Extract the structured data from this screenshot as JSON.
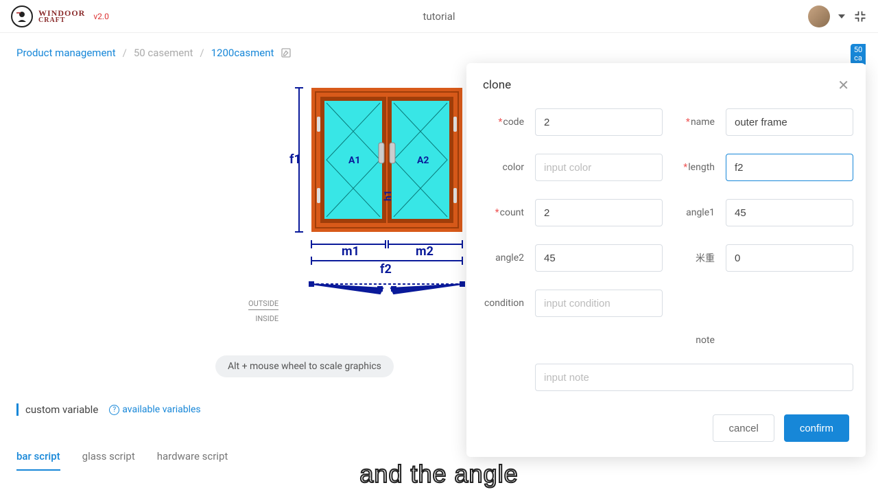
{
  "header": {
    "brand1": "WINDOOR",
    "brand2": "CRAFT",
    "version": "v2.0",
    "title": "tutorial"
  },
  "breadcrumb": {
    "a": "Product management",
    "b": "50 casement",
    "c": "1200casment"
  },
  "sidebadge": {
    "l1": "50",
    "l2": "ca"
  },
  "drawing": {
    "f1": "f1",
    "f2": "f2",
    "m1": "m1",
    "m2": "m2",
    "h1": "h1",
    "a1": "A1",
    "a2": "A2",
    "outside": "OUTSIDE",
    "inside": "INSIDE"
  },
  "hint": "Alt + mouse wheel to scale graphics",
  "vars": {
    "custom": "custom variable",
    "available": "available variables"
  },
  "tabs": {
    "bar": "bar script",
    "glass": "glass script",
    "hardware": "hardware script"
  },
  "dialog": {
    "title": "clone",
    "labels": {
      "code": "code",
      "name": "name",
      "color": "color",
      "length": "length",
      "count": "count",
      "angle1": "angle1",
      "angle2": "angle2",
      "mizhong": "米重",
      "condition": "condition",
      "note": "note"
    },
    "values": {
      "code": "2",
      "name": "outer frame",
      "color": "",
      "length": "f2",
      "count": "2",
      "angle1": "45",
      "angle2": "45",
      "mizhong": "0",
      "condition": "",
      "note": ""
    },
    "placeholders": {
      "color": "input color",
      "condition": "input condition",
      "note": "input note"
    },
    "cancel": "cancel",
    "confirm": "confirm"
  },
  "subtitle": "and the angle"
}
